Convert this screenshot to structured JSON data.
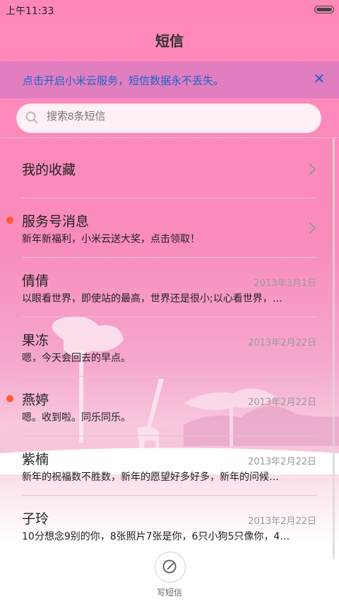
{
  "status_bar": {
    "time": "上午11:33"
  },
  "header": {
    "title": "短信"
  },
  "banner": {
    "text": "点击开启小米云服务，短信数据永不丢失。",
    "close_icon": "close-icon"
  },
  "search": {
    "placeholder": "搜索8条短信",
    "icon": "search-icon"
  },
  "conversations": [
    {
      "name": "我的收藏",
      "snippet": "",
      "date": "",
      "unread": false,
      "has_chevron": true
    },
    {
      "name": "服务号消息",
      "snippet": "新年新福利，小米云送大奖，点击领取！",
      "date": "",
      "unread": true,
      "has_chevron": true
    },
    {
      "name": "倩倩",
      "snippet": "以眼看世界，即使站的最高，世界还是很小;以心看世界，…",
      "date": "2013年3月1日",
      "unread": false,
      "has_chevron": false
    },
    {
      "name": "果冻",
      "snippet": "嗯，今天会回去的早点。",
      "date": "2013年2月22日",
      "unread": false,
      "has_chevron": false
    },
    {
      "name": "燕婷",
      "snippet": "嗯。收到啦。同乐同乐。",
      "date": "2013年2月22日",
      "unread": true,
      "has_chevron": false
    },
    {
      "name": "紫楠",
      "snippet": "新年的祝福数不胜数，新年的愿望好多好多，新年的问候…",
      "date": "2013年2月22日",
      "unread": false,
      "has_chevron": false
    },
    {
      "name": "子玲",
      "snippet": "10分想念9别的你，8张照片7张是你，6只小狗5只像你，4…",
      "date": "2013年2月22日",
      "unread": false,
      "has_chevron": false
    }
  ],
  "compose": {
    "label": "写短信",
    "icon": "compose-icon"
  },
  "colors": {
    "accent": "#1f64c9",
    "unread_dot": "#ff5d2f",
    "banner_bg": "#e07ec0"
  }
}
